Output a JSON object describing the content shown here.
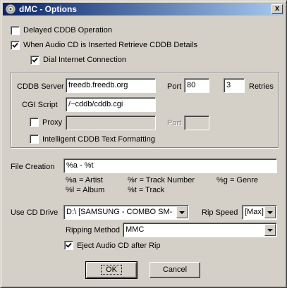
{
  "window": {
    "title": "dMC - Options",
    "close_label": "x"
  },
  "options": {
    "delayed_cddb": {
      "label": "Delayed CDDB Operation",
      "checked": false
    },
    "auto_retrieve": {
      "label": "When Audio CD is Inserted Retrieve CDDB Details",
      "checked": true
    },
    "dial_internet": {
      "label": "Dial Internet Connection",
      "checked": true
    }
  },
  "cddb": {
    "server_label": "CDDB Server",
    "server_value": "freedb.freedb.org",
    "port_label": "Port",
    "port_value": "80",
    "retries_value": "3",
    "retries_label": "Retries",
    "cgi_label": "CGI Script",
    "cgi_value": "/~cddb/cddb.cgi",
    "proxy_label": "Proxy",
    "proxy_value": "",
    "proxy_port_label": "Port",
    "proxy_port_value": "",
    "intelligent_label": "Intelligent CDDB Text Formatting"
  },
  "file_creation": {
    "label": "File Creation",
    "value": "%a - %t",
    "legend": [
      "%a = Artist",
      "%r = Track Number",
      "%g = Genre",
      "%l = Album",
      "%t = Track"
    ]
  },
  "drive": {
    "label": "Use CD Drive",
    "value": "D:\\   [SAMSUNG  - COMBO SM-",
    "speed_label": "Rip Speed",
    "speed_value": "[Max]",
    "method_label": "Ripping Method",
    "method_value": "MMC",
    "eject_label": "Eject Audio CD after Rip",
    "eject_checked": true
  },
  "buttons": {
    "ok": "OK",
    "cancel": "Cancel"
  }
}
